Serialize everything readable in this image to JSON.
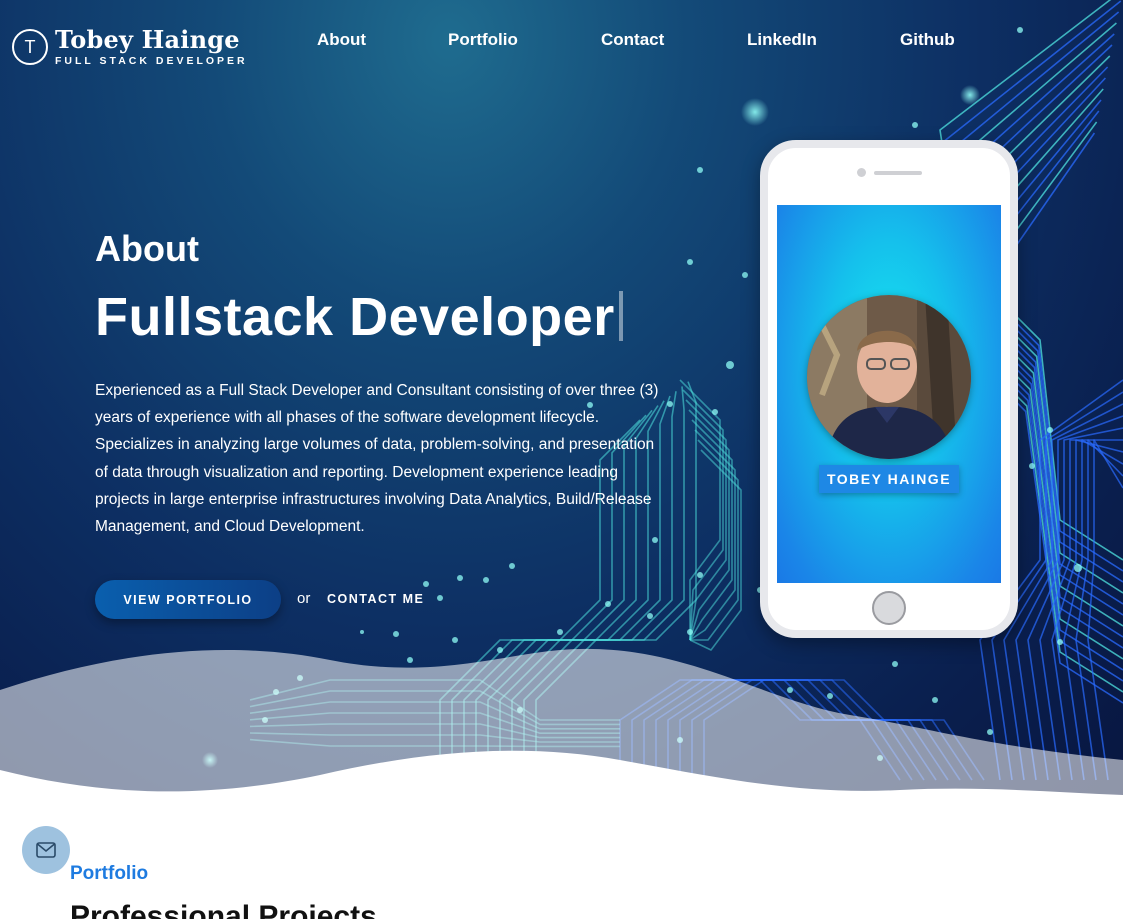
{
  "header": {
    "logo_letter": "T",
    "name": "Tobey Hainge",
    "subtitle": "FULL STACK DEVELOPER"
  },
  "nav": {
    "items": [
      "About",
      "Portfolio",
      "Contact",
      "LinkedIn",
      "Github"
    ]
  },
  "hero": {
    "section_label": "About",
    "title": "Fullstack Developer",
    "description": "Experienced as a Full Stack Developer and Consultant consisting of over three (3) years of experience with all phases of the software development lifecycle. Specializes in analyzing large volumes of data, problem-solving, and presentation of data through visualization and reporting. Development experience leading projects in large enterprise infrastructures involving Data Analytics, Build/Release Management, and Cloud Development.",
    "primary_button": "VIEW PORTFOLIO",
    "or_text": "or",
    "secondary_button": "CONTACT ME"
  },
  "phone": {
    "name_badge": "TOBEY HAINGE"
  },
  "portfolio": {
    "label": "Portfolio",
    "title": "Professional Projects"
  },
  "icons": {
    "mail": "mail-icon",
    "logo": "logo-circle-icon"
  },
  "colors": {
    "hero_dark": "#0a1f4e",
    "accent_blue": "#1e7be0",
    "circuit_cyan": "#4fe3e0",
    "circuit_blue": "#2a6bff"
  }
}
